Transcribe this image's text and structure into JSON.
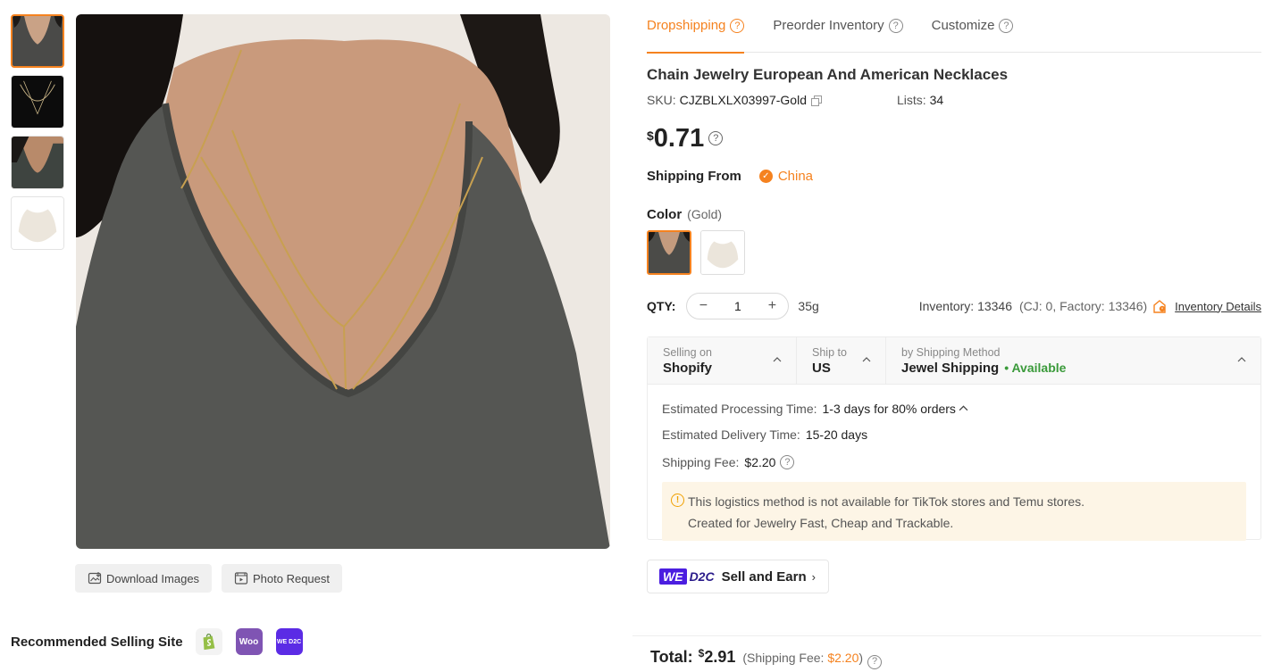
{
  "gallery": {
    "download_label": "Download Images",
    "photo_request_label": "Photo Request",
    "thumbnails": [
      "thumbnail-1",
      "thumbnail-2",
      "thumbnail-3",
      "thumbnail-4"
    ]
  },
  "recommended": {
    "label": "Recommended Selling Site",
    "sites": [
      "shopify-icon",
      "woocommerce-icon",
      "wed2c-icon"
    ],
    "woo_text": "Woo",
    "wed2c_text": "WE D2C"
  },
  "tabs": [
    {
      "label": "Dropshipping",
      "active": true
    },
    {
      "label": "Preorder Inventory",
      "active": false
    },
    {
      "label": "Customize",
      "active": false
    }
  ],
  "product": {
    "title": "Chain Jewelry European And American Necklaces",
    "sku_label": "SKU:",
    "sku": "CJZBLXLX03997-Gold",
    "lists_label": "Lists:",
    "lists": "34",
    "price_currency": "$",
    "price": "0.71"
  },
  "shipping_from": {
    "label": "Shipping From",
    "value": "China"
  },
  "color": {
    "label": "Color",
    "selected": "(Gold)"
  },
  "qty": {
    "label": "QTY:",
    "value": "1",
    "minus": "−",
    "plus": "+",
    "weight": "35g"
  },
  "inventory": {
    "label": "Inventory: 13346",
    "detail": "(CJ: 0, Factory: 13346)",
    "link": "Inventory Details"
  },
  "shipping": {
    "selling_on_label": "Selling on",
    "selling_on": "Shopify",
    "ship_to_label": "Ship to",
    "ship_to": "US",
    "method_label": "by Shipping Method",
    "method": "Jewel Shipping",
    "availability": "• Available",
    "processing_label": "Estimated Processing Time:",
    "processing": "1-3 days for 80% orders",
    "delivery_label": "Estimated Delivery Time:",
    "delivery": "15-20 days",
    "fee_label": "Shipping Fee:",
    "fee": "$2.20",
    "notice_line1": "This logistics method is not available for TikTok stores and Temu stores.",
    "notice_line2": "Created for Jewelry Fast, Cheap and Trackable."
  },
  "d2c": {
    "we": "WE",
    "d2c": "D2C",
    "label": "Sell and Earn"
  },
  "total": {
    "label": "Total:",
    "currency": "$",
    "amount": "2.91",
    "fee_prefix": "(Shipping Fee: ",
    "fee": "$2.20",
    "fee_suffix": ")"
  },
  "colors": {
    "accent": "#f5821f",
    "available": "#3a9a3a",
    "notice_bg": "#fdf5e6"
  }
}
